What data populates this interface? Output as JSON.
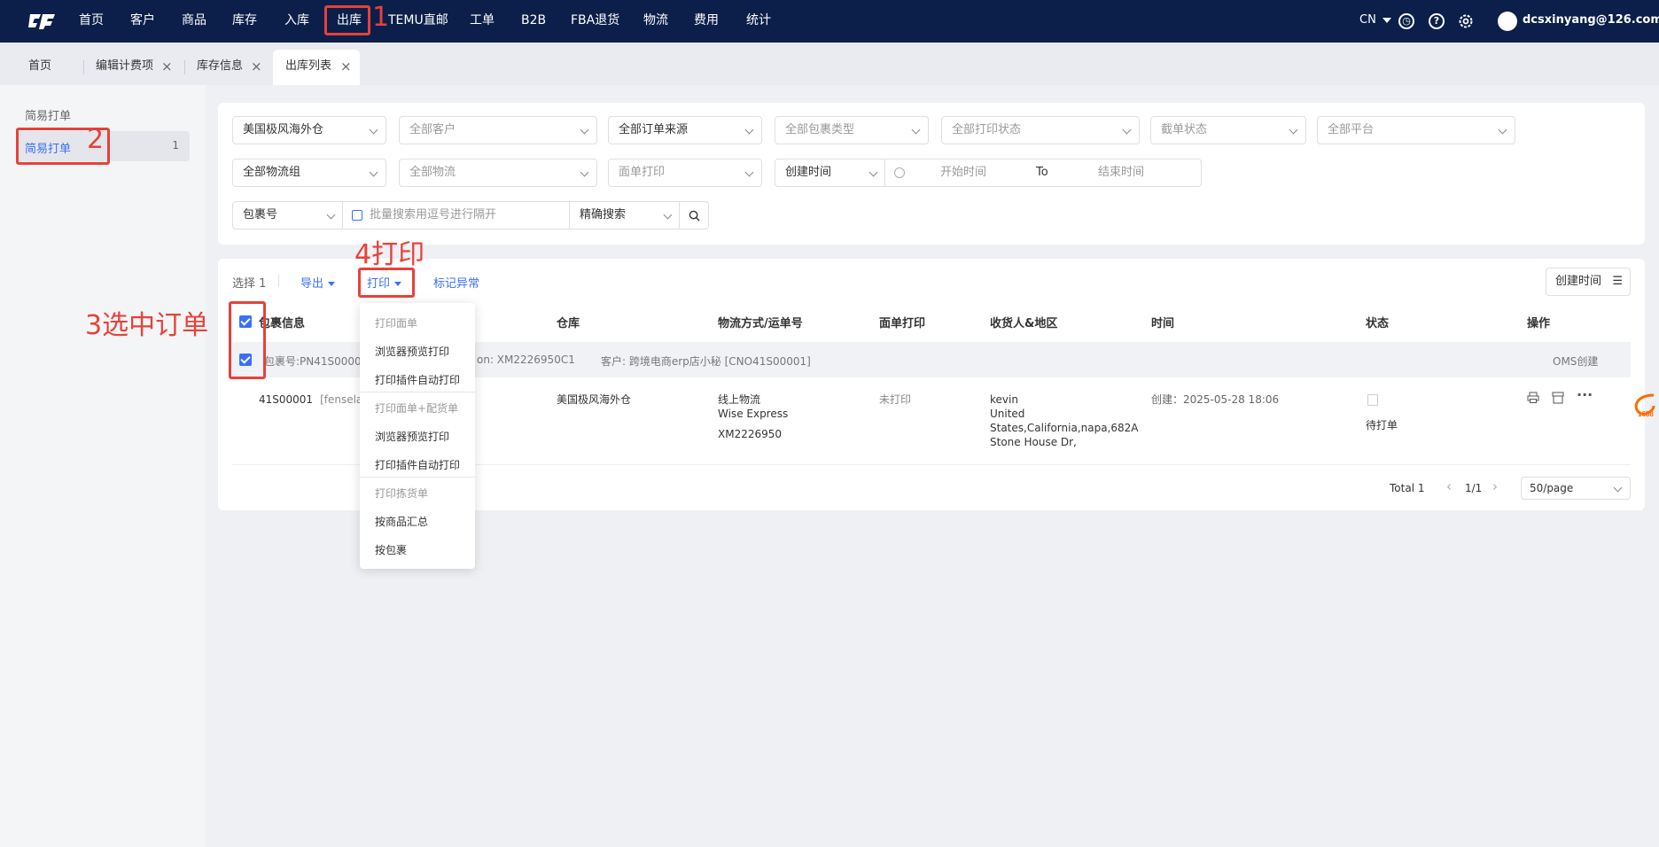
{
  "nav": {
    "items": [
      "首页",
      "客户",
      "商品",
      "库存",
      "入库",
      "出库",
      "TEMU直邮",
      "工单",
      "B2B",
      "FBA退货",
      "物流",
      "费用",
      "统计"
    ],
    "lang": "CN",
    "user": "dcsxinyang@126.com"
  },
  "tabs": [
    "首页",
    "编辑计费项",
    "库存信息",
    "出库列表"
  ],
  "sidebar": {
    "title": "简易打单",
    "item_label": "简易打单",
    "item_count": "1"
  },
  "filters": {
    "warehouse": "美国极风海外仓",
    "customer": "全部客户",
    "order_source": "全部订单来源",
    "package_type": "全部包裹类型",
    "print_status": "全部打印状态",
    "cutoff_status": "截单状态",
    "platform": "全部平台",
    "logistics_group": "全部物流组",
    "logistics": "全部物流",
    "label_print": "面单打印",
    "time_type": "创建时间",
    "start_time": "开始时间",
    "to": "To",
    "end_time": "结束时间",
    "search_type": "包裹号",
    "search_placeholder": "批量搜索用逗号进行隔开",
    "search_mode": "精确搜索"
  },
  "toolbar": {
    "selected": "选择 1",
    "export": "导出",
    "print": "打印",
    "mark_abnormal": "标记异常",
    "sort": "创建时间"
  },
  "table": {
    "headers": [
      "包裹信息",
      "仓库",
      "物流方式/运单号",
      "面单打印",
      "收货人&地区",
      "时间",
      "状态",
      "操作"
    ],
    "group": {
      "package": "包裹号:PN41S00001",
      "ref": "on:  XM2226950C1",
      "customer": "客户: 跨境电商erp店小秘  [CNO41S00001]",
      "created_by": "OMS创建"
    },
    "row": {
      "package": "41S00001",
      "package_extra": "[fenselaga",
      "warehouse": "美国极风海外仓",
      "logistics_type": "线上物流",
      "carrier": "Wise Express",
      "tracking": "XM2226950",
      "print_status": "未打印",
      "receiver_name": "kevin",
      "receiver_country": "United",
      "receiver_region": "States,California,napa,682A",
      "receiver_street": "Stone House Dr,",
      "time": "创建：2025-05-28 18:06",
      "status": "待打单"
    }
  },
  "pagination": {
    "total": "Total 1",
    "page": "1/1",
    "page_size": "50/page"
  },
  "print_menu": {
    "items": [
      "打印面单",
      "浏览器预览打印",
      "打印插件自动打印",
      "打印面单+配货单",
      "浏览器预览打印",
      "打印插件自动打印",
      "打印拣货单",
      "按商品汇总",
      "按包裹"
    ]
  },
  "annotations": {
    "a1": "1",
    "a2": "2",
    "a3": "3选中订单",
    "a4": "4打印"
  },
  "colors": {
    "nav_bg": "#0b1f4a",
    "accent": "#3a6ff7",
    "annotation": "#e8413a"
  }
}
